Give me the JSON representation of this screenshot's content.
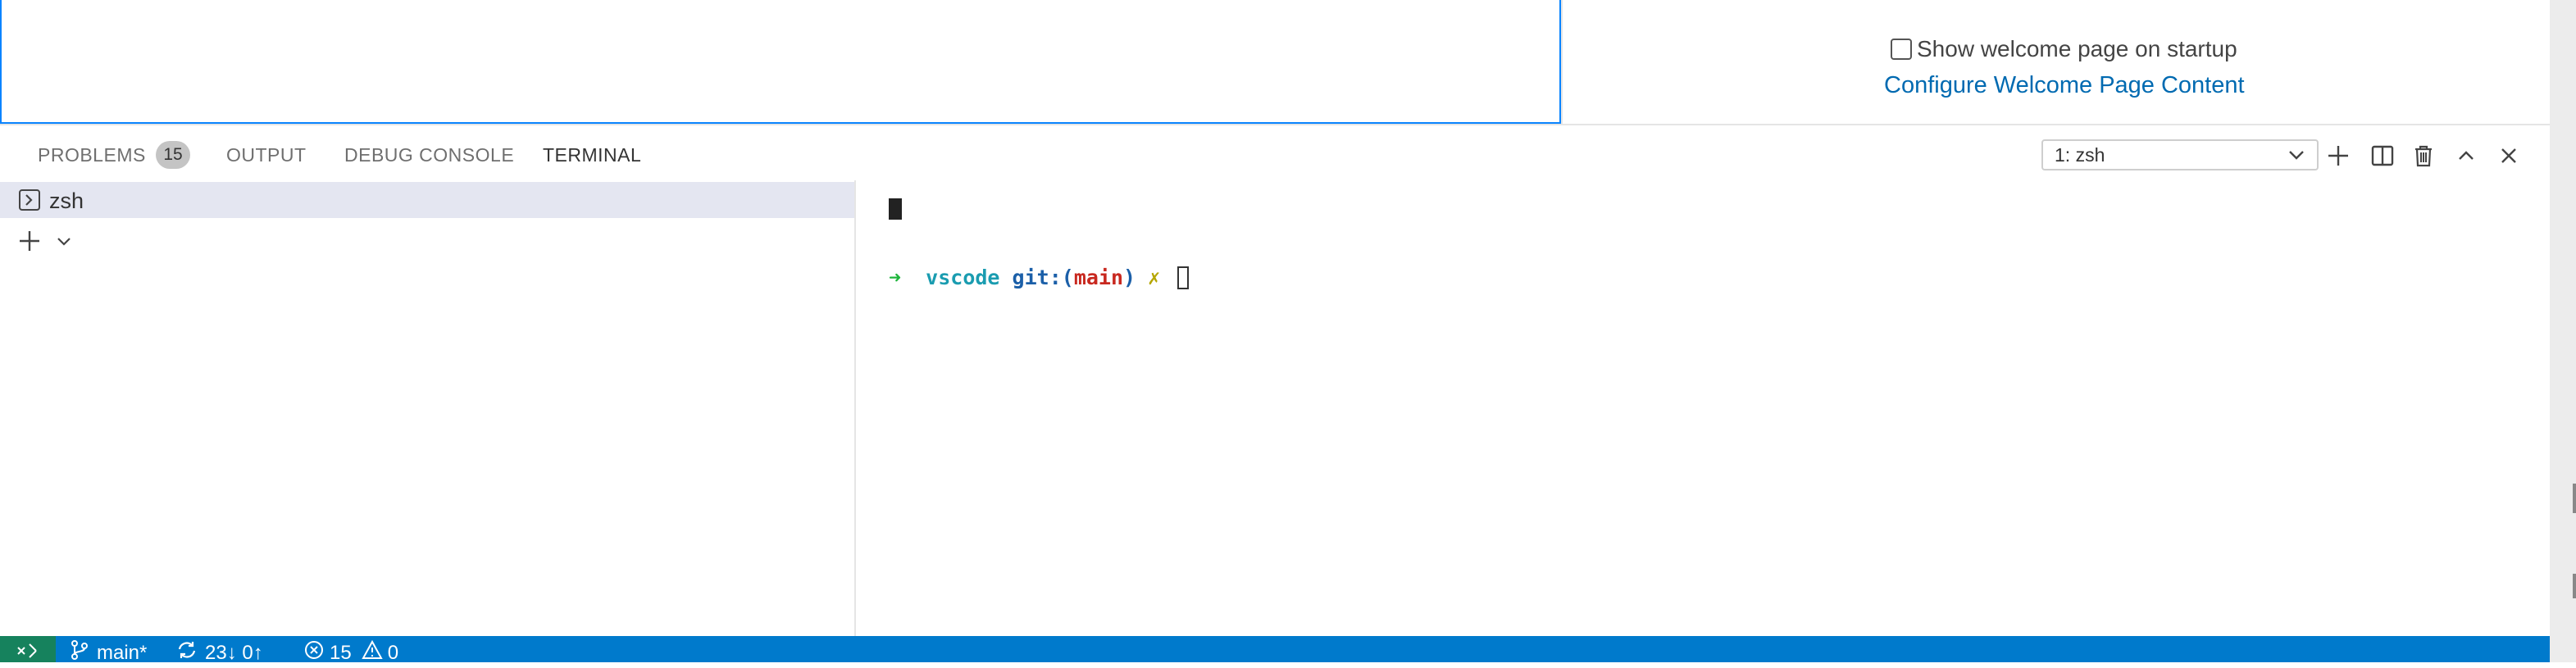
{
  "welcome": {
    "show_on_startup_label": "Show welcome page on startup",
    "configure_link": "Configure Welcome Page Content"
  },
  "panel": {
    "tabs": [
      {
        "label": "PROBLEMS",
        "badge": "15"
      },
      {
        "label": "OUTPUT"
      },
      {
        "label": "DEBUG CONSOLE"
      },
      {
        "label": "TERMINAL",
        "active": true
      }
    ],
    "terminal_select": "1: zsh"
  },
  "terminal_tabs": {
    "items": [
      {
        "label": "zsh",
        "icon": "terminal-icon"
      }
    ]
  },
  "terminal": {
    "prompt_arrow": "➜",
    "dir": "vscode",
    "git_prefix": "git:(",
    "branch": "main",
    "git_suffix": ")",
    "dirty_marker": "✗"
  },
  "status_bar": {
    "branch": "main*",
    "sync": "23↓ 0↑",
    "errors": "15",
    "warnings": "0"
  },
  "colors": {
    "status_bar": "#007acc",
    "remote_indicator": "#16825d",
    "link": "#006ab1",
    "active_border": "#0a84ff"
  }
}
